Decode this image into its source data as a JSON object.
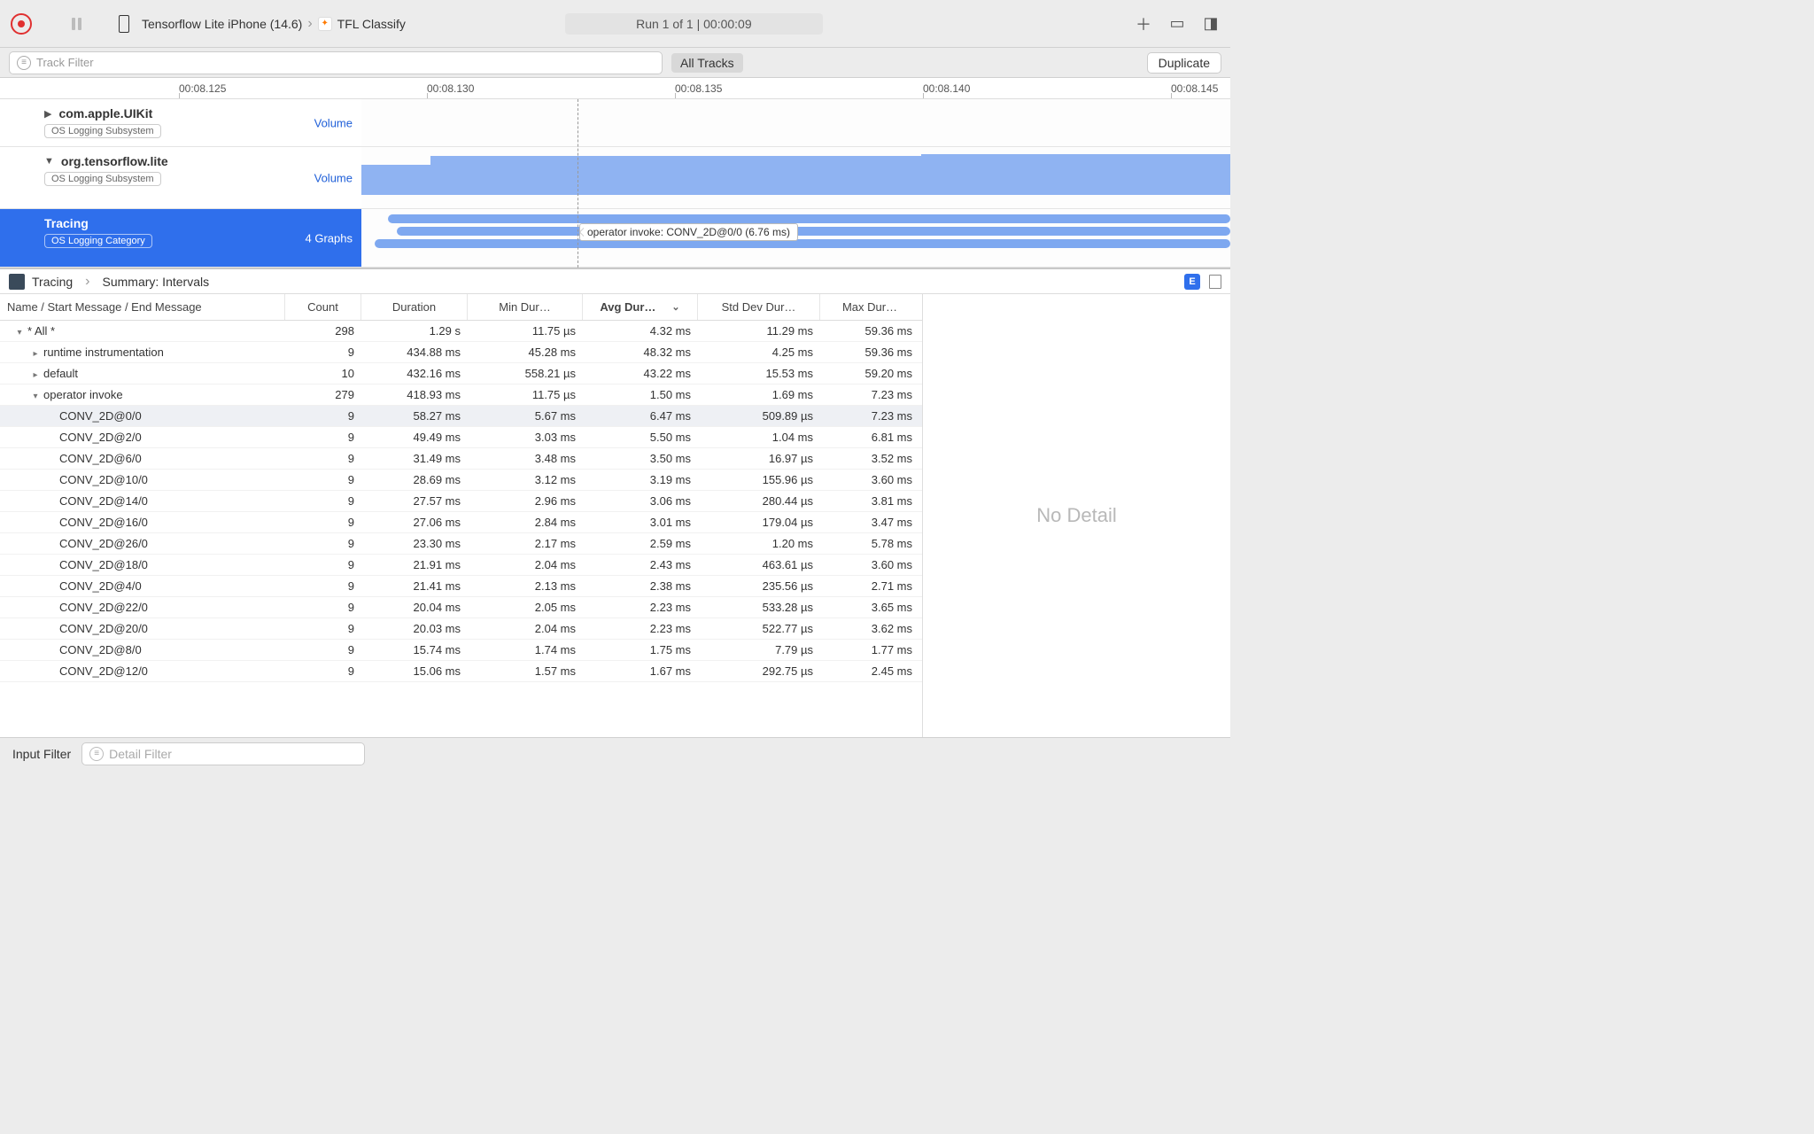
{
  "toolbar": {
    "device": "Tensorflow Lite iPhone (14.6)",
    "app": "TFL Classify",
    "run_status": "Run 1 of 1  |  00:00:09",
    "duplicate": "Duplicate"
  },
  "filterbar": {
    "track_placeholder": "Track Filter",
    "all_tracks": "All Tracks"
  },
  "ruler": {
    "t0": "00:08.125",
    "t1": "00:08.130",
    "t2": "00:08.135",
    "t3": "00:08.140",
    "t4": "00:08.145"
  },
  "tracks": {
    "uikit": {
      "title": "com.apple.UIKit",
      "tag": "OS Logging Subsystem",
      "right": "Volume"
    },
    "tflite": {
      "title": "org.tensorflow.lite",
      "tag": "OS Logging Subsystem",
      "right": "Volume"
    },
    "tracing": {
      "title": "Tracing",
      "tag": "OS Logging Category",
      "right": "4 Graphs"
    },
    "tooltip": "operator invoke: CONV_2D@0/0 (6.76 ms)"
  },
  "detail": {
    "breadcrumb1": "Tracing",
    "breadcrumb2": "Summary: Intervals",
    "no_detail": "No Detail",
    "ebadge": "E"
  },
  "columns": {
    "name": "Name / Start Message / End Message",
    "count": "Count",
    "dur": "Duration",
    "min": "Min Dur…",
    "avg": "Avg Dur…",
    "std": "Std Dev Dur…",
    "max": "Max Dur…"
  },
  "rows": [
    {
      "indent": 0,
      "disc": "▾",
      "name": "* All *",
      "count": "298",
      "dur": "1.29 s",
      "min": "11.75 µs",
      "avg": "4.32 ms",
      "std": "11.29 ms",
      "max": "59.36 ms"
    },
    {
      "indent": 1,
      "disc": "▸",
      "name": "runtime instrumentation",
      "count": "9",
      "dur": "434.88 ms",
      "min": "45.28 ms",
      "avg": "48.32 ms",
      "std": "4.25 ms",
      "max": "59.36 ms"
    },
    {
      "indent": 1,
      "disc": "▸",
      "name": "default",
      "count": "10",
      "dur": "432.16 ms",
      "min": "558.21 µs",
      "avg": "43.22 ms",
      "std": "15.53 ms",
      "max": "59.20 ms"
    },
    {
      "indent": 1,
      "disc": "▾",
      "name": "operator invoke",
      "count": "279",
      "dur": "418.93 ms",
      "min": "11.75 µs",
      "avg": "1.50 ms",
      "std": "1.69 ms",
      "max": "7.23 ms"
    },
    {
      "indent": 2,
      "disc": "",
      "name": "CONV_2D@0/0",
      "count": "9",
      "dur": "58.27 ms",
      "min": "5.67 ms",
      "avg": "6.47 ms",
      "std": "509.89 µs",
      "max": "7.23 ms",
      "sel": true
    },
    {
      "indent": 2,
      "disc": "",
      "name": "CONV_2D@2/0",
      "count": "9",
      "dur": "49.49 ms",
      "min": "3.03 ms",
      "avg": "5.50 ms",
      "std": "1.04 ms",
      "max": "6.81 ms"
    },
    {
      "indent": 2,
      "disc": "",
      "name": "CONV_2D@6/0",
      "count": "9",
      "dur": "31.49 ms",
      "min": "3.48 ms",
      "avg": "3.50 ms",
      "std": "16.97 µs",
      "max": "3.52 ms"
    },
    {
      "indent": 2,
      "disc": "",
      "name": "CONV_2D@10/0",
      "count": "9",
      "dur": "28.69 ms",
      "min": "3.12 ms",
      "avg": "3.19 ms",
      "std": "155.96 µs",
      "max": "3.60 ms"
    },
    {
      "indent": 2,
      "disc": "",
      "name": "CONV_2D@14/0",
      "count": "9",
      "dur": "27.57 ms",
      "min": "2.96 ms",
      "avg": "3.06 ms",
      "std": "280.44 µs",
      "max": "3.81 ms"
    },
    {
      "indent": 2,
      "disc": "",
      "name": "CONV_2D@16/0",
      "count": "9",
      "dur": "27.06 ms",
      "min": "2.84 ms",
      "avg": "3.01 ms",
      "std": "179.04 µs",
      "max": "3.47 ms"
    },
    {
      "indent": 2,
      "disc": "",
      "name": "CONV_2D@26/0",
      "count": "9",
      "dur": "23.30 ms",
      "min": "2.17 ms",
      "avg": "2.59 ms",
      "std": "1.20 ms",
      "max": "5.78 ms"
    },
    {
      "indent": 2,
      "disc": "",
      "name": "CONV_2D@18/0",
      "count": "9",
      "dur": "21.91 ms",
      "min": "2.04 ms",
      "avg": "2.43 ms",
      "std": "463.61 µs",
      "max": "3.60 ms"
    },
    {
      "indent": 2,
      "disc": "",
      "name": "CONV_2D@4/0",
      "count": "9",
      "dur": "21.41 ms",
      "min": "2.13 ms",
      "avg": "2.38 ms",
      "std": "235.56 µs",
      "max": "2.71 ms"
    },
    {
      "indent": 2,
      "disc": "",
      "name": "CONV_2D@22/0",
      "count": "9",
      "dur": "20.04 ms",
      "min": "2.05 ms",
      "avg": "2.23 ms",
      "std": "533.28 µs",
      "max": "3.65 ms"
    },
    {
      "indent": 2,
      "disc": "",
      "name": "CONV_2D@20/0",
      "count": "9",
      "dur": "20.03 ms",
      "min": "2.04 ms",
      "avg": "2.23 ms",
      "std": "522.77 µs",
      "max": "3.62 ms"
    },
    {
      "indent": 2,
      "disc": "",
      "name": "CONV_2D@8/0",
      "count": "9",
      "dur": "15.74 ms",
      "min": "1.74 ms",
      "avg": "1.75 ms",
      "std": "7.79 µs",
      "max": "1.77 ms"
    },
    {
      "indent": 2,
      "disc": "",
      "name": "CONV_2D@12/0",
      "count": "9",
      "dur": "15.06 ms",
      "min": "1.57 ms",
      "avg": "1.67 ms",
      "std": "292.75 µs",
      "max": "2.45 ms"
    }
  ],
  "footer": {
    "input_filter": "Input Filter",
    "detail_placeholder": "Detail Filter"
  }
}
